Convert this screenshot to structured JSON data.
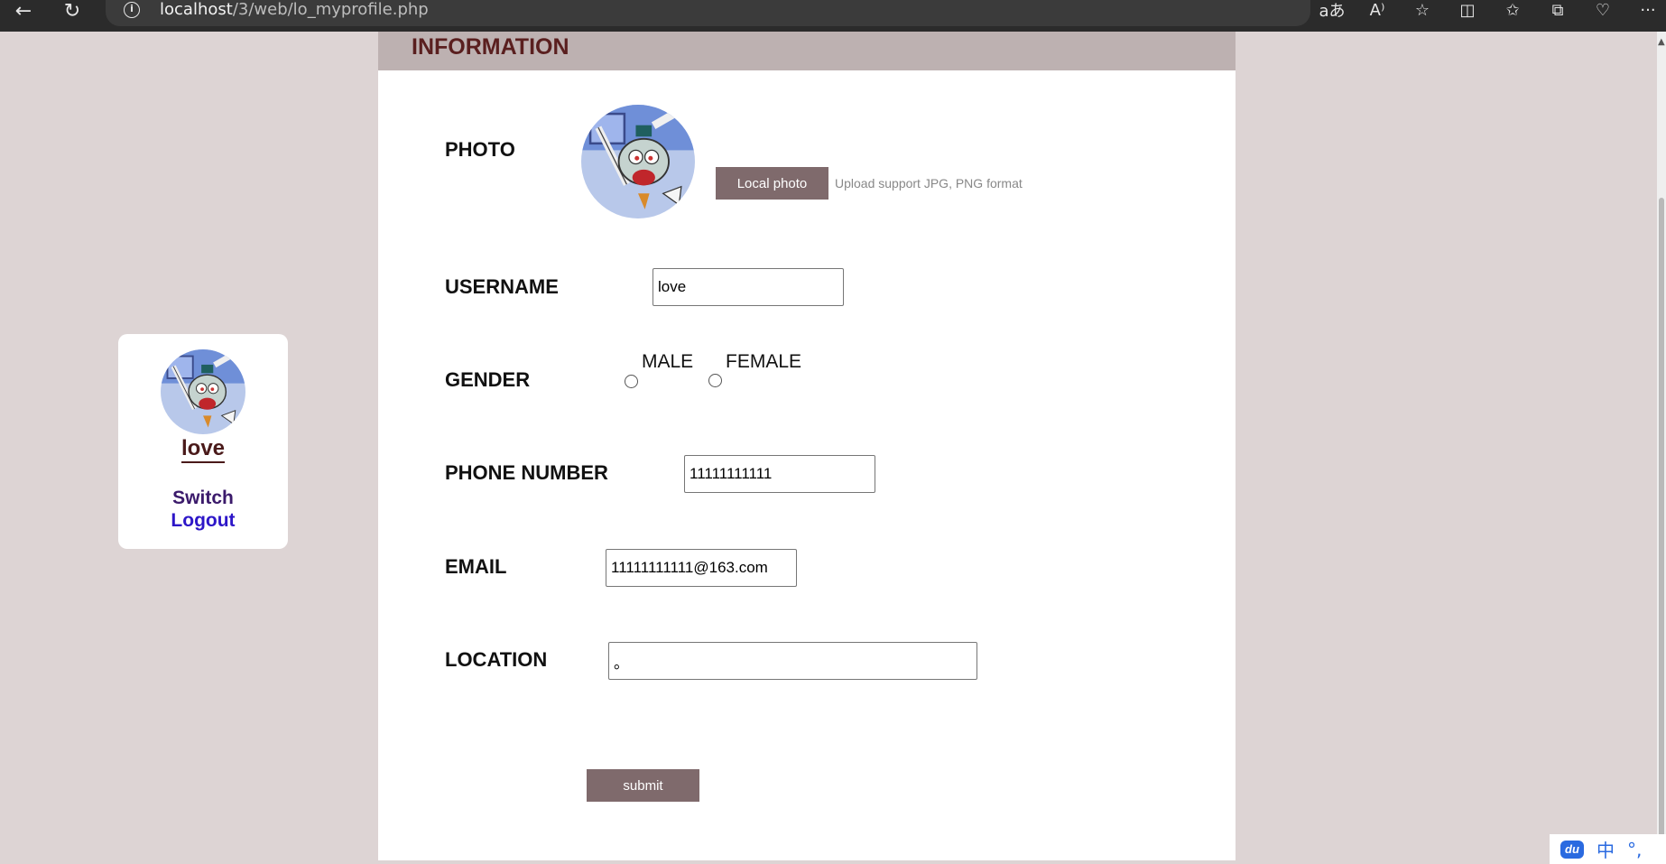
{
  "browser": {
    "url_host": "localhost",
    "url_path": "/3/web/lo_myprofile.php",
    "icons": [
      "back-icon",
      "refresh-icon",
      "info-icon",
      "translate-icon",
      "read-aloud-icon",
      "favorite-star-icon",
      "split-screen-icon",
      "favorites-icon",
      "collections-icon",
      "health-icon",
      "more-icon"
    ]
  },
  "sidebar": {
    "username": "love",
    "switch_label": "Switch",
    "logout_label": "Logout"
  },
  "panel": {
    "title": "INFORMATION",
    "photo_label": "PHOTO",
    "local_photo_button": "Local photo",
    "upload_hint": "Upload support JPG, PNG format",
    "username_label": "USERNAME",
    "username_value": "love",
    "gender_label": "GENDER",
    "gender_male": "MALE",
    "gender_female": "FEMALE",
    "phone_label": "PHONE NUMBER",
    "phone_value": "11111111111",
    "email_label": "EMAIL",
    "email_value": "11111111111@163.com",
    "location_label": "LOCATION",
    "location_value": "。",
    "submit_label": "submit"
  },
  "ime": {
    "logo": "du",
    "mode": "中",
    "punct": "°,"
  },
  "colors": {
    "page_bg": "#ddd4d4",
    "header_bg": "#bdb1b1",
    "title_color": "#5a1f1f",
    "button_bg": "#7f6a6c",
    "logout_color": "#2d16c8"
  }
}
